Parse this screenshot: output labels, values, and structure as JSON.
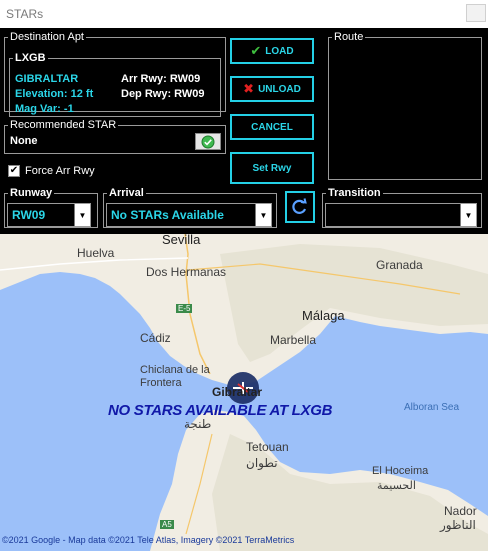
{
  "window": {
    "title": "STARs"
  },
  "destination": {
    "legend": "Destination Apt",
    "icao_legend": "LXGB",
    "name": "GIBRALTAR",
    "elevation": "Elevation: 12 ft",
    "magvar": "Mag Var: -1",
    "arr_rwy": "Arr Rwy: RW09",
    "dep_rwy": "Dep Rwy: RW09"
  },
  "recommended": {
    "legend": "Recommended STAR",
    "value": "None"
  },
  "force_arr_rwy": {
    "label": "Force Arr Rwy",
    "checked": true,
    "mark": "✔"
  },
  "buttons": {
    "load": "LOAD",
    "unload": "UNLOAD",
    "cancel": "CANCEL",
    "set_rwy": "Set Rwy"
  },
  "route": {
    "legend": "Route"
  },
  "runway": {
    "legend": "Runway",
    "value": "RW09"
  },
  "arrival": {
    "legend": "Arrival",
    "value": "No STARs Available"
  },
  "transition": {
    "legend": "Transition",
    "value": ""
  },
  "map": {
    "labels": {
      "sevilla": "Sevilla",
      "huelva": "Huelva",
      "dos_hermanas": "Dos Hermanas",
      "granada": "Granada",
      "malaga": "Málaga",
      "marbella": "Marbella",
      "cadiz": "Cádiz",
      "chiclana": "Chiclana de la Frontera",
      "gibraltar": "Gibraltar",
      "tangier_ar": "طنجة",
      "tetouan": "Tetouan",
      "tetouan_ar": "تطوان",
      "alboran": "Alboran Sea",
      "alhoceima": "El Hoceima",
      "alhoceima_ar": "الحسيمة",
      "nador": "Nador",
      "nador_ar": "الناظور",
      "road_e5": "E-5",
      "road_a5": "A5"
    },
    "message": "NO STARS AVAILABLE AT LXGB",
    "credit": "©2021 Google - Map data ©2021 Tele Atlas, Imagery ©2021 TerraMetrics"
  },
  "colors": {
    "accent": "#2bd6e8",
    "panel": "#000000",
    "sea": "#9cc0f9",
    "land": "#f2efe6",
    "message": "#1018a8"
  }
}
